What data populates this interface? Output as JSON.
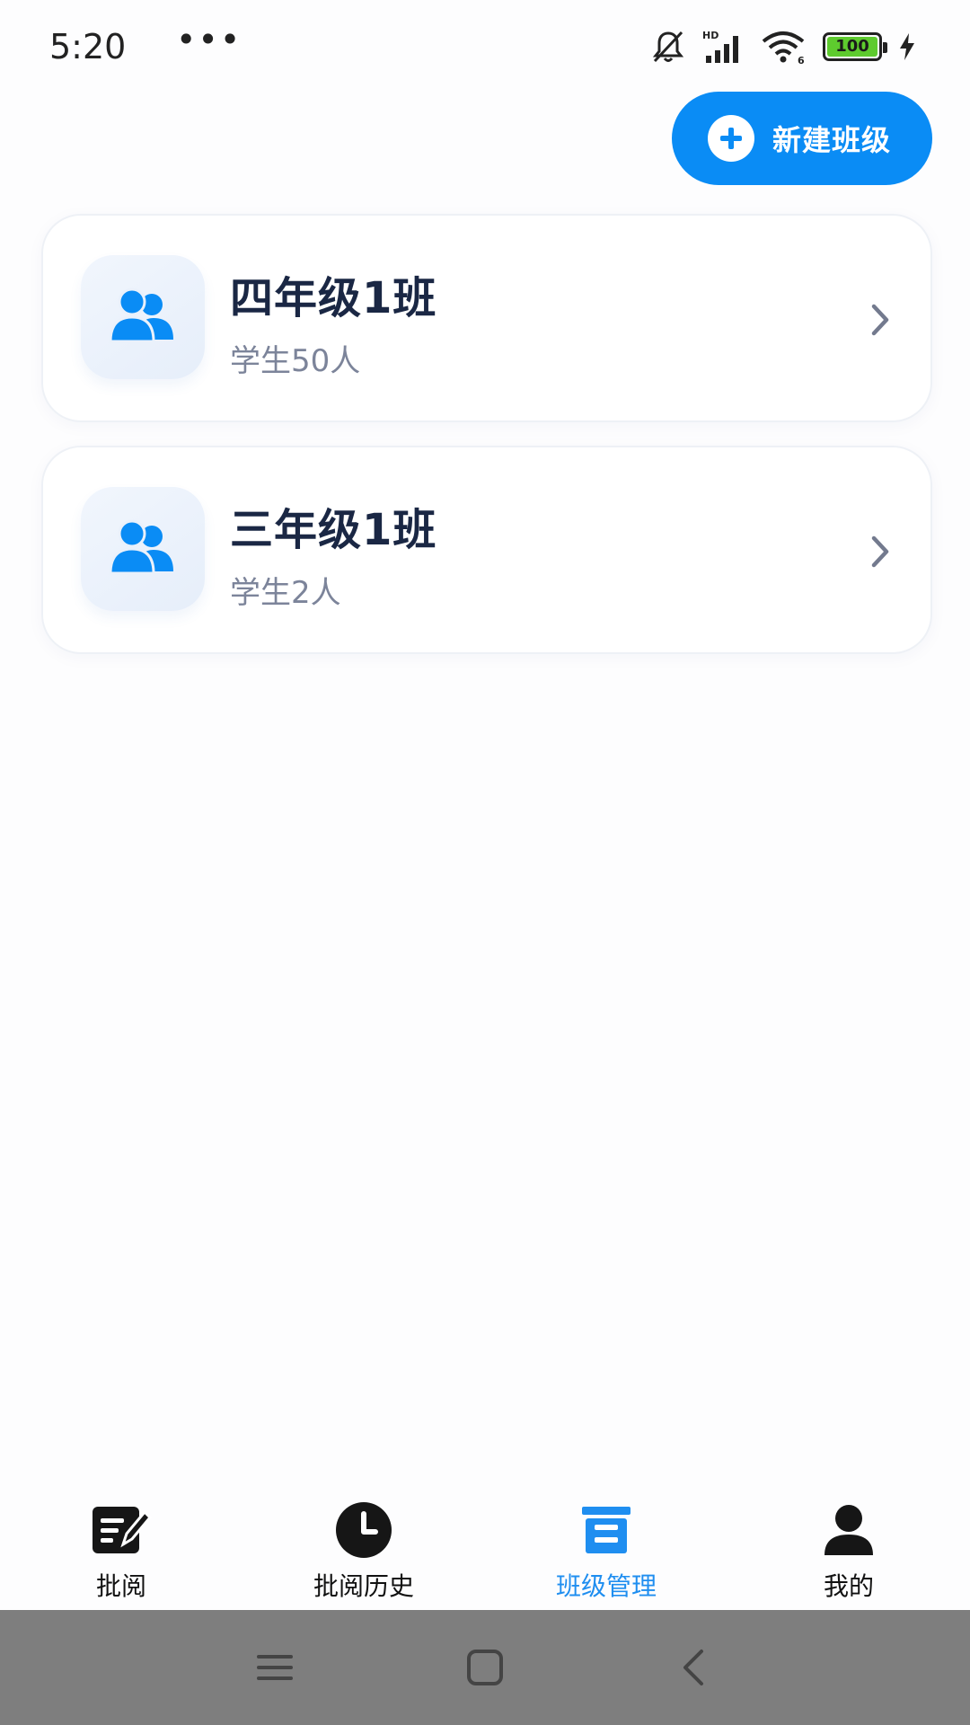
{
  "status_bar": {
    "time": "5:20",
    "more": "•••",
    "battery_level": "100",
    "network_label": "HD",
    "wifi_label": "6"
  },
  "header": {
    "new_class_button": "新建班级"
  },
  "classes": [
    {
      "name": "四年级1班",
      "students": "学生50人"
    },
    {
      "name": "三年级1班",
      "students": "学生2人"
    }
  ],
  "tabs": [
    {
      "label": "批阅",
      "icon": "grading-icon",
      "active": false
    },
    {
      "label": "批阅历史",
      "icon": "clock-icon",
      "active": false
    },
    {
      "label": "班级管理",
      "icon": "class-management-icon",
      "active": true
    },
    {
      "label": "我的",
      "icon": "person-icon",
      "active": false
    }
  ],
  "colors": {
    "accent": "#0a8cf5",
    "active_tab": "#1f8ef0",
    "title_text": "#1a2744",
    "sub_text": "#7c849a",
    "nav_bar": "#7e7e7e"
  }
}
